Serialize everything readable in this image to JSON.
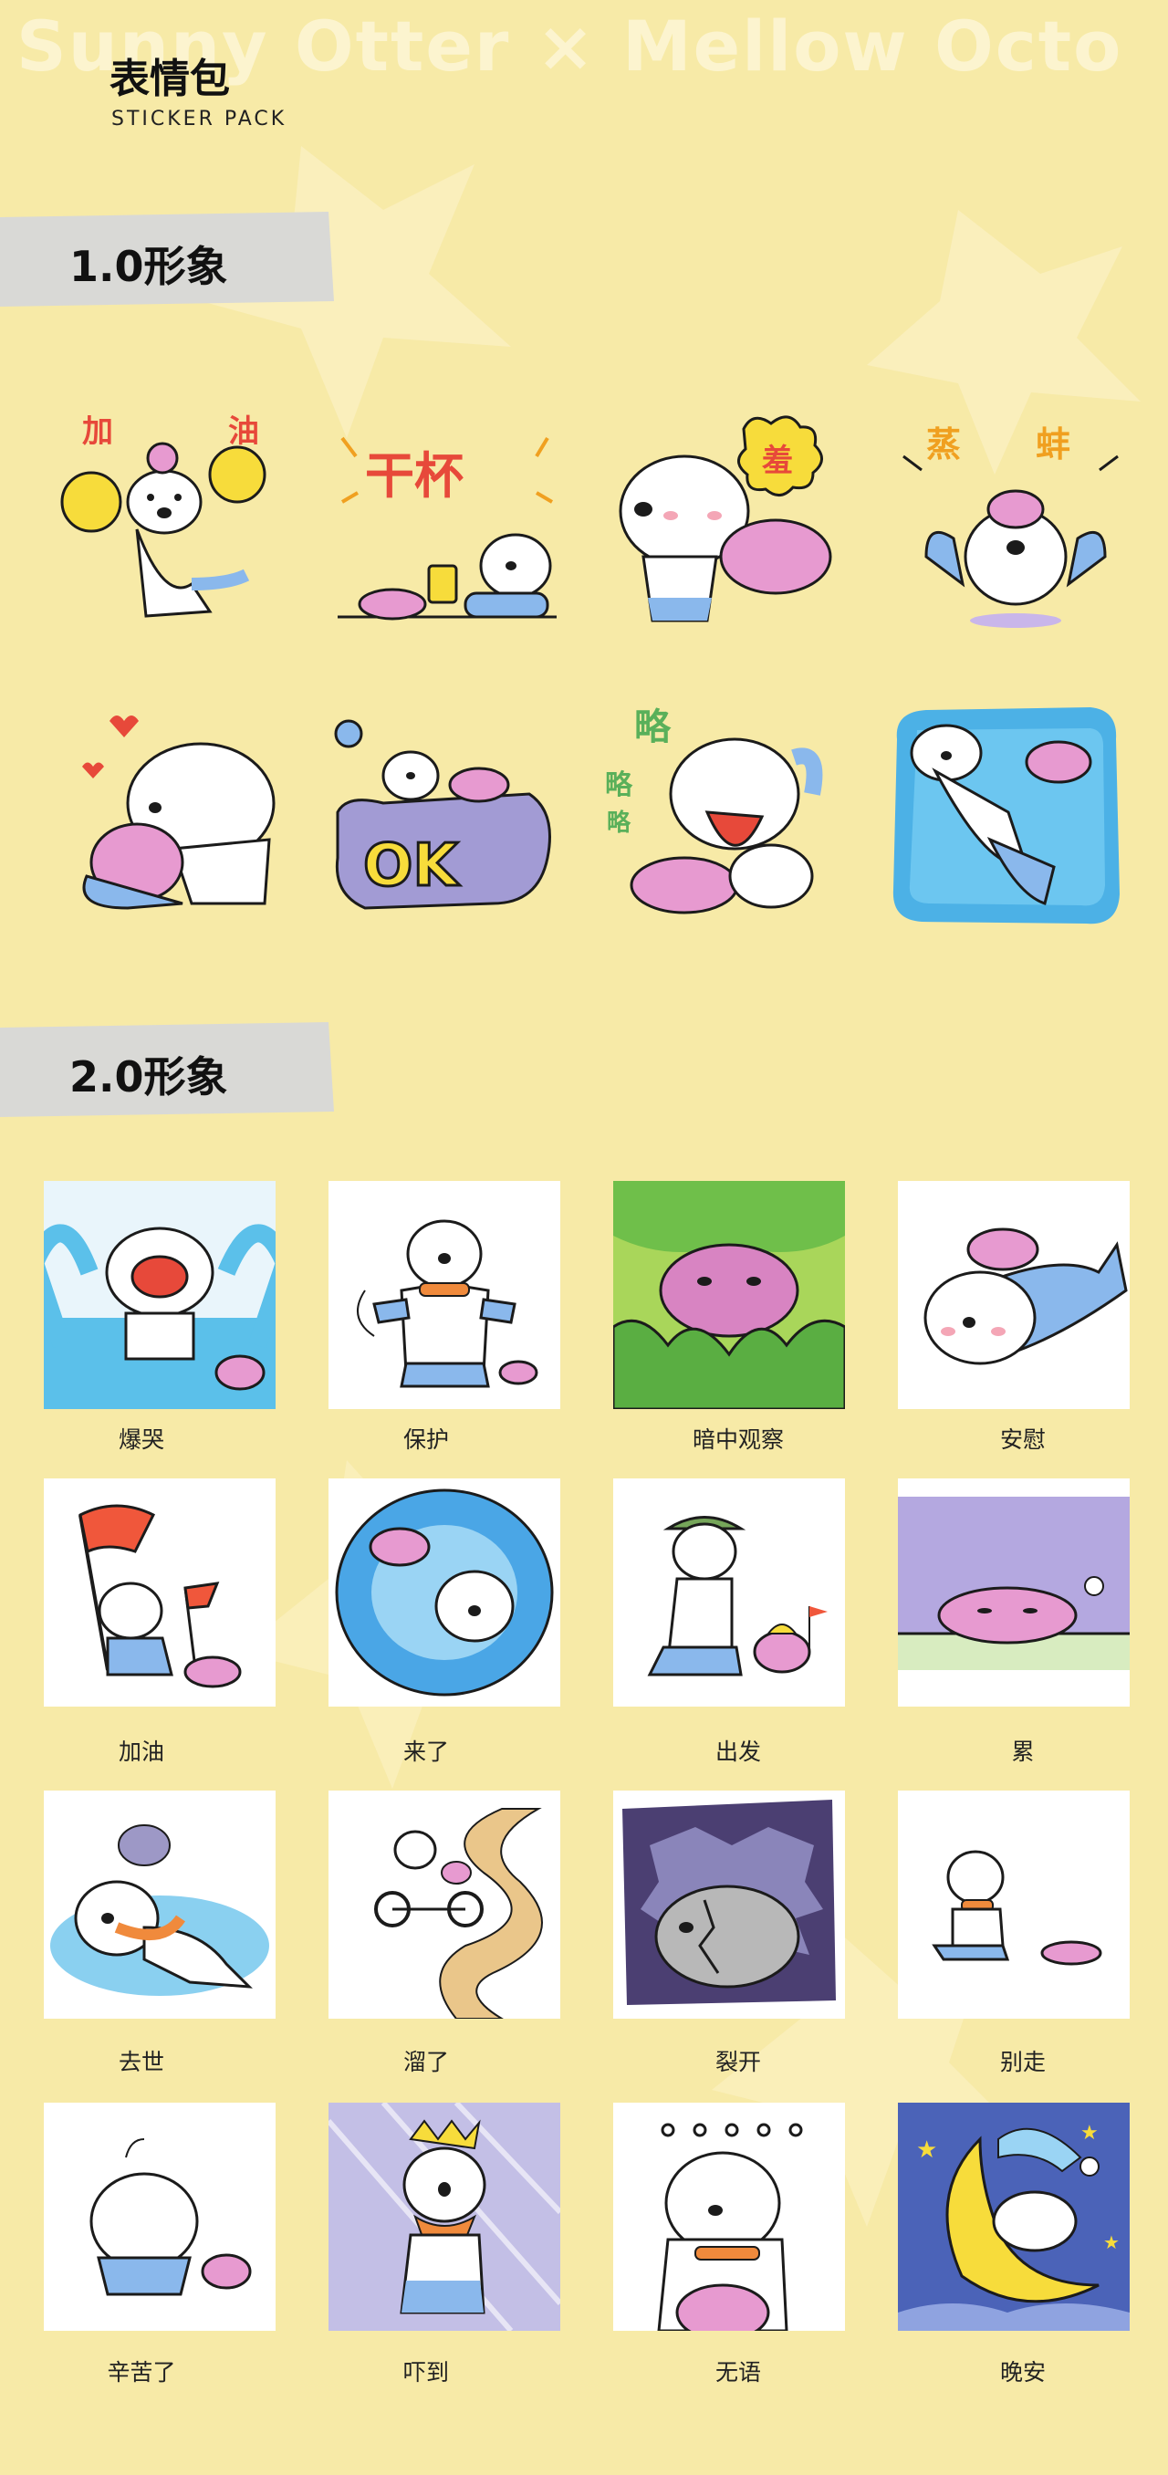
{
  "watermark": "Sunny Otter × Mellow Octo",
  "header": {
    "title": "表情包",
    "subtitle": "STICKER PACK"
  },
  "sections": [
    {
      "label": "1.0形象",
      "stickers": [
        {
          "icon": "cheer-otter-octo-sticker",
          "words": [
            "加",
            "油"
          ]
        },
        {
          "icon": "toast-otter-octo-sticker",
          "words": [
            "干杯"
          ]
        },
        {
          "icon": "shy-otter-octo-sticker",
          "words": [
            "羞"
          ]
        },
        {
          "icon": "shocked-octo-sticker",
          "words": [
            "蒸",
            "蚌"
          ]
        },
        {
          "icon": "hug-octo-sticker",
          "words": []
        },
        {
          "icon": "ok-sign-sticker",
          "words": [
            "OK"
          ]
        },
        {
          "icon": "tongue-out-sticker",
          "words": [
            "略",
            "略",
            "略"
          ]
        },
        {
          "icon": "floating-in-water-sticker",
          "words": []
        }
      ]
    },
    {
      "label": "2.0形象",
      "stickers": [
        {
          "icon": "crying-otter-icon",
          "caption": "爆哭"
        },
        {
          "icon": "protect-otter-icon",
          "caption": "保护"
        },
        {
          "icon": "spying-octo-icon",
          "caption": "暗中观察"
        },
        {
          "icon": "comfort-otter-icon",
          "caption": "安慰"
        },
        {
          "icon": "flag-otter-icon",
          "caption": "加油"
        },
        {
          "icon": "water-swirl-icon",
          "caption": "来了"
        },
        {
          "icon": "hiking-otter-icon",
          "caption": "出发"
        },
        {
          "icon": "tired-octo-icon",
          "caption": "累"
        },
        {
          "icon": "fainted-otter-icon",
          "caption": "去世"
        },
        {
          "icon": "bicycle-otter-icon",
          "caption": "溜了"
        },
        {
          "icon": "cracked-rock-icon",
          "caption": "裂开"
        },
        {
          "icon": "dont-go-otter-icon",
          "caption": "别走"
        },
        {
          "icon": "bowing-otter-icon",
          "caption": "辛苦了"
        },
        {
          "icon": "scared-otter-icon",
          "caption": "吓到"
        },
        {
          "icon": "speechless-otter-icon",
          "caption": "无语"
        },
        {
          "icon": "sleeping-moon-icon",
          "caption": "晚安"
        }
      ]
    }
  ],
  "colors": {
    "background": "#f7eaa7",
    "label_bar": "#d9d9d6",
    "otter_white": "#ffffff",
    "otter_blue": "#8ab8ec",
    "octo_pink": "#e79ad0",
    "scarf_orange": "#f08a3c",
    "outline": "#1b1b1b"
  }
}
